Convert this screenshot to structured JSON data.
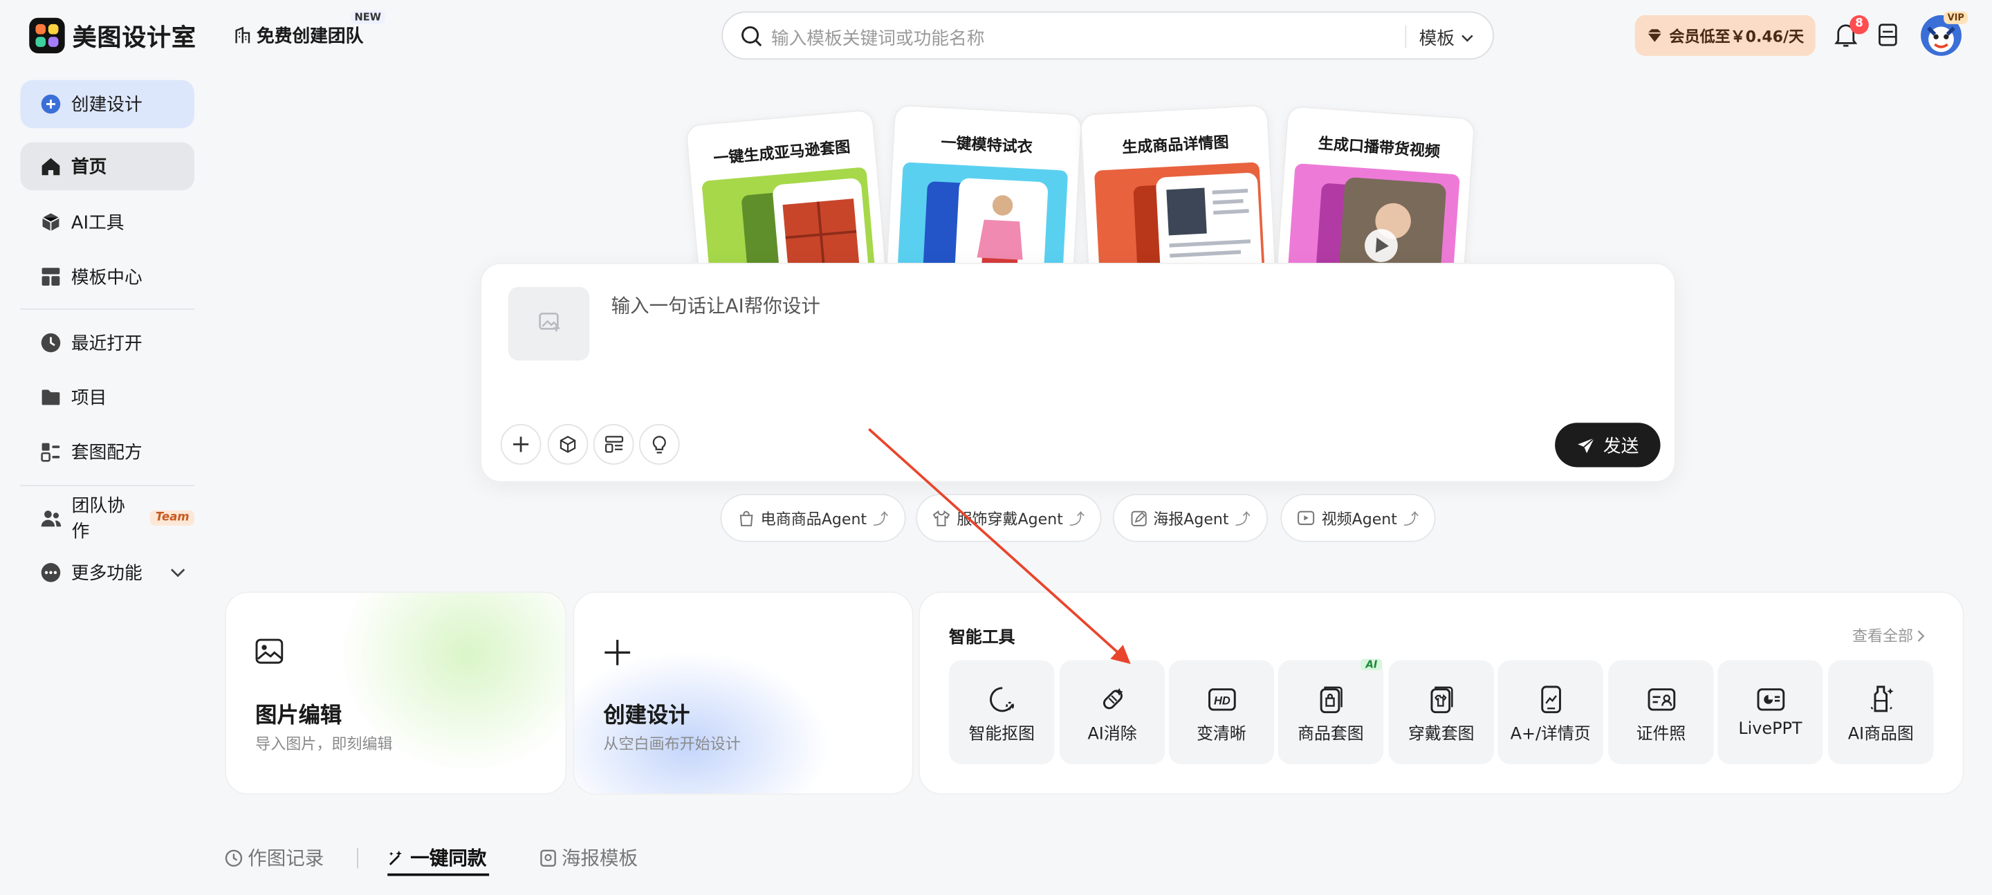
{
  "header": {
    "app_name": "美图设计室",
    "team_button": "免费创建团队",
    "new_badge": "NEW",
    "search_placeholder": "输入模板关键词或功能名称",
    "search_scope": "模板",
    "vip_offer": "会员低至￥0.46/天",
    "notification_count": "8",
    "vip_tag": "VIP"
  },
  "sidebar": {
    "create": "创建设计",
    "items": [
      {
        "label": "首页",
        "icon": "home-icon"
      },
      {
        "label": "AI工具",
        "icon": "cube-icon"
      },
      {
        "label": "模板中心",
        "icon": "layout-icon"
      },
      {
        "label": "最近打开",
        "icon": "clock-icon"
      },
      {
        "label": "项目",
        "icon": "folder-icon"
      },
      {
        "label": "套图配方",
        "icon": "recipe-icon"
      },
      {
        "label": "团队协作",
        "icon": "users-icon"
      },
      {
        "label": "更多功能",
        "icon": "more-icon"
      }
    ],
    "team_chip": "Team"
  },
  "hero_cards": [
    {
      "title": "一键生成亚马逊套图",
      "color": "#a6d84a"
    },
    {
      "title": "一键模特试衣",
      "color": "#5ad0f0"
    },
    {
      "title": "生成商品详情图",
      "color": "#e8623e"
    },
    {
      "title": "生成口播带货视频",
      "color": "#ee7ad8"
    }
  ],
  "prompt": {
    "placeholder": "输入一句话让AI帮你设计",
    "send": "发送"
  },
  "agents": [
    "电商商品Agent",
    "服饰穿戴Agent",
    "海报Agent",
    "视频Agent"
  ],
  "agent_arrow": "⤴",
  "features": {
    "image_edit": {
      "title": "图片编辑",
      "sub": "导入图片，即刻编辑"
    },
    "create_design": {
      "title": "创建设计",
      "sub": "从空白画布开始设计"
    }
  },
  "tools": {
    "title": "智能工具",
    "view_all": "查看全部",
    "ai_chip": "AI",
    "items": [
      "智能抠图",
      "AI消除",
      "变清晰",
      "商品套图",
      "穿戴套图",
      "A+/详情页",
      "证件照",
      "LivePPT",
      "AI商品图"
    ]
  },
  "bottom_tabs": [
    "作图记录",
    "一键同款",
    "海报模板"
  ],
  "colors": {
    "accent": "#3b6fd8",
    "annotation_arrow": "#e8452c"
  }
}
